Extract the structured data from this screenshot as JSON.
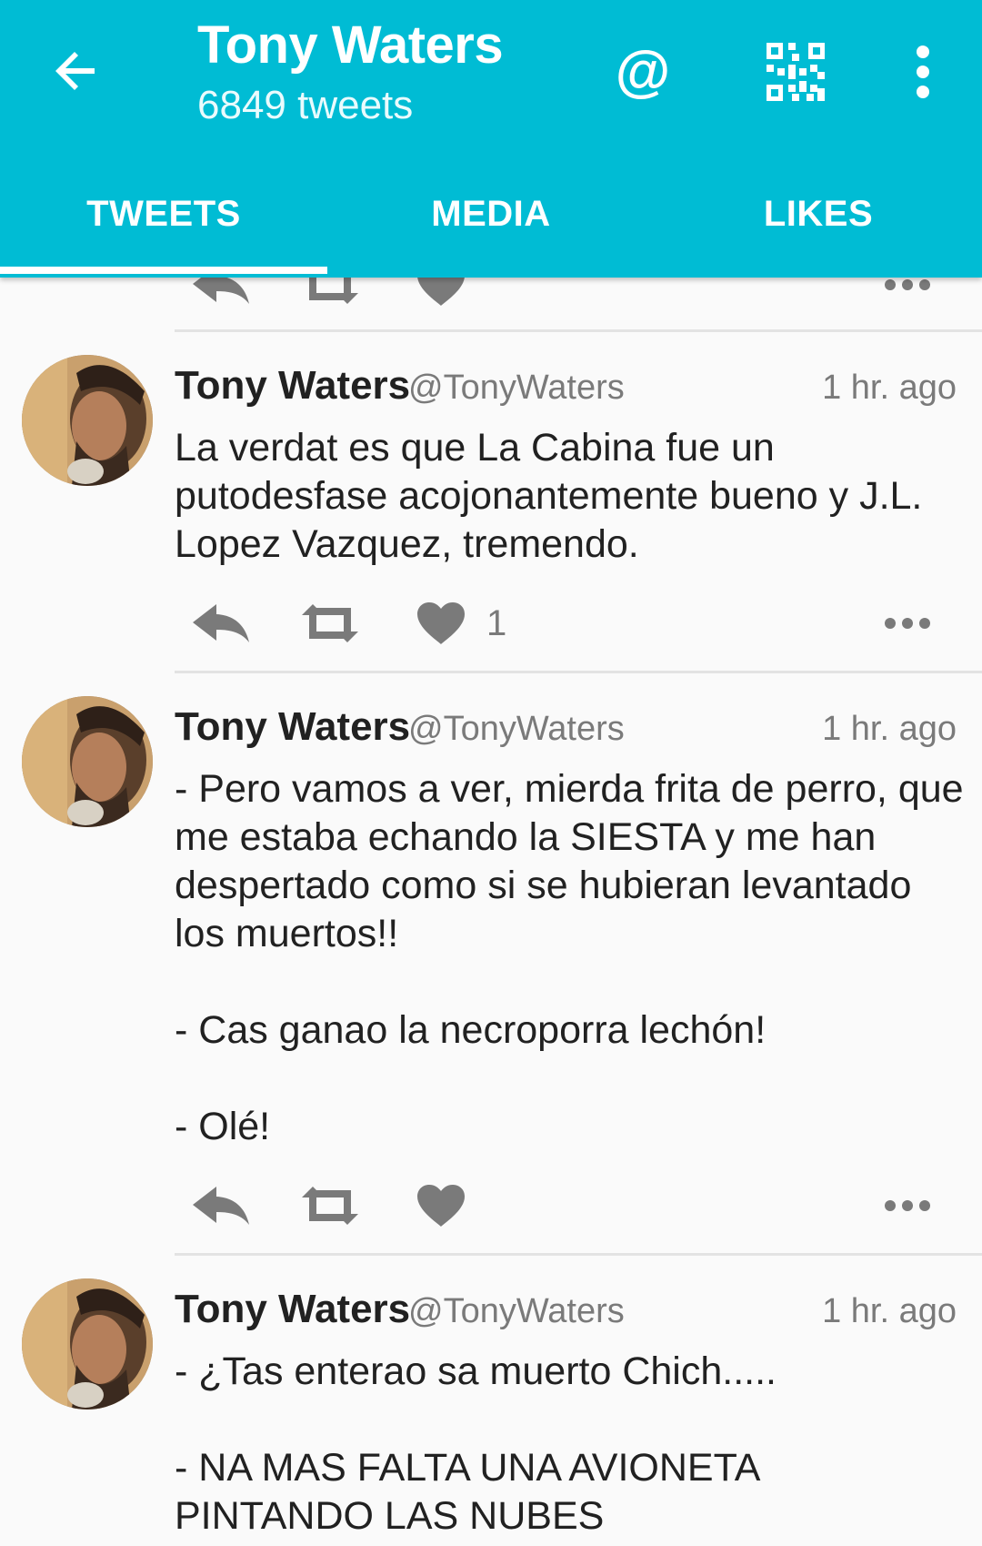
{
  "header": {
    "title": "Tony Waters",
    "subtitle": "6849 tweets"
  },
  "tabs": [
    {
      "label": "TWEETS",
      "active": true
    },
    {
      "label": "MEDIA",
      "active": false
    },
    {
      "label": "LIKES",
      "active": false
    }
  ],
  "icons": {
    "back": "arrow-left-icon",
    "mention": "at-sign-icon",
    "qr": "qr-code-icon",
    "overflow": "more-vert-icon"
  },
  "mention_symbol": "@",
  "colors": {
    "appbar": "#00bcd4",
    "action_gray": "#7a7a7a",
    "text": "#212121"
  },
  "tweets": [
    {
      "name": "Tony Waters",
      "handle": "@TonyWaters",
      "time": "1 hr. ago",
      "text": "La verdat es que La Cabina fue un putodesfase acojonantemente bueno y J.L. Lopez Vazquez, tremendo.",
      "likes": "1"
    },
    {
      "name": "Tony Waters",
      "handle": "@TonyWaters",
      "time": "1 hr. ago",
      "text": "- Pero vamos a ver, mierda frita de perro, que me estaba echando la SIESTA y me han despertado como si se hubieran levantado los muertos!!\n\n- Cas ganao la necroporra lechón!\n\n- Olé!",
      "likes": ""
    },
    {
      "name": "Tony Waters",
      "handle": "@TonyWaters",
      "time": "1 hr. ago",
      "text": "- ¿Tas enterao sa muerto Chich.....\n\n- NA MAS FALTA UNA AVIONETA PINTANDO LAS NUBES",
      "likes": ""
    }
  ]
}
